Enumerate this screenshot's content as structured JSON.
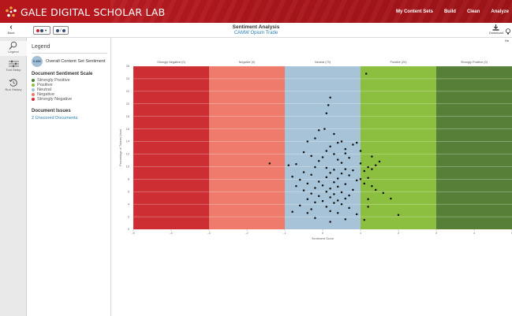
{
  "header": {
    "brand": "GALE DIGITAL SCHOLAR LAB",
    "nav": [
      "My Content Sets",
      "Build",
      "Clean",
      "Analyze"
    ]
  },
  "toolbar": {
    "back_label": "Back",
    "title": "Sentiment Analysis",
    "subtitle": "CAMW Opium Trade",
    "download_label": "Download",
    "help_label": "He"
  },
  "rail": {
    "items": [
      {
        "label": "Legend",
        "icon": "legend-icon"
      },
      {
        "label": "Tool Setup",
        "icon": "sliders-icon"
      },
      {
        "label": "Run History",
        "icon": "history-icon"
      }
    ]
  },
  "legend": {
    "title": "Legend",
    "overall_value": "0.452",
    "overall_label": "Overall Content Set Sentiment",
    "scale_title": "Document Sentiment Scale",
    "scale": [
      {
        "label": "Strongly Positive",
        "color": "#4b7a32"
      },
      {
        "label": "Positive",
        "color": "#8cbf3f"
      },
      {
        "label": "Neutral",
        "color": "#a3bfd6"
      },
      {
        "label": "Negative",
        "color": "#e8796b"
      },
      {
        "label": "Strongly Negative",
        "color": "#cc2e33"
      }
    ],
    "issues_title": "Document Issues",
    "issues_link": "2 Unscored Documents"
  },
  "chart_data": {
    "type": "scatter",
    "xlabel": "Sentiment Score",
    "ylabel": "Percentage of Tokens Used",
    "xlim": [
      -5,
      5
    ],
    "ylim": [
      0,
      26
    ],
    "x_ticks": [
      -5,
      -4,
      -3,
      -2,
      -1,
      0,
      1,
      2,
      3,
      4,
      5
    ],
    "y_ticks": [
      0,
      2,
      4,
      6,
      8,
      10,
      12,
      14,
      16,
      18,
      20,
      22,
      24,
      26
    ],
    "bands": [
      {
        "label": "Strongly Negative (0)",
        "from": -5,
        "to": -3,
        "color": "#cc2e33"
      },
      {
        "label": "Negative (0)",
        "from": -3,
        "to": -1,
        "color": "#ee7b6c"
      },
      {
        "label": "Neutral (79)",
        "from": -1,
        "to": 1,
        "color": "#a6c3d8"
      },
      {
        "label": "Positive (20)",
        "from": 1,
        "to": 3,
        "color": "#8cbf3f"
      },
      {
        "label": "Strongly Positive (0)",
        "from": 3,
        "to": 5,
        "color": "#587f38"
      }
    ],
    "points": [
      [
        0.2,
        21
      ],
      [
        0.15,
        19.8
      ],
      [
        0.1,
        18.5
      ],
      [
        0.05,
        16
      ],
      [
        -0.1,
        15.8
      ],
      [
        0.3,
        15.2
      ],
      [
        -0.2,
        14.5
      ],
      [
        -0.4,
        14
      ],
      [
        0.5,
        14
      ],
      [
        0.8,
        13.5
      ],
      [
        0.4,
        13.8
      ],
      [
        0.9,
        13.8
      ],
      [
        0.2,
        13.2
      ],
      [
        0.6,
        12.8
      ],
      [
        0.1,
        12.5
      ],
      [
        0.6,
        12.1
      ],
      [
        0.3,
        12
      ],
      [
        -0.3,
        11.7
      ],
      [
        0.7,
        11.4
      ],
      [
        0.4,
        11.1
      ],
      [
        -0.1,
        10.9
      ],
      [
        0.5,
        10.6
      ],
      [
        -0.7,
        10.4
      ],
      [
        -0.9,
        10.2
      ],
      [
        -0.2,
        9.9
      ],
      [
        0.1,
        9.8
      ],
      [
        0.6,
        9.6
      ],
      [
        0.3,
        9.5
      ],
      [
        0.8,
        9.4
      ],
      [
        -0.5,
        9.1
      ],
      [
        0.2,
        9.0
      ],
      [
        0.5,
        8.9
      ],
      [
        -0.3,
        8.7
      ],
      [
        0.7,
        8.6
      ],
      [
        -0.8,
        8.4
      ],
      [
        0.1,
        8.3
      ],
      [
        0.4,
        8.1
      ],
      [
        -0.6,
        7.9
      ],
      [
        0.9,
        7.8
      ],
      [
        -0.1,
        7.6
      ],
      [
        0.3,
        7.5
      ],
      [
        -0.4,
        7.3
      ],
      [
        0.6,
        7.2
      ],
      [
        0.0,
        7.0
      ],
      [
        -0.7,
        6.9
      ],
      [
        0.4,
        6.8
      ],
      [
        -0.2,
        6.6
      ],
      [
        0.2,
        6.5
      ],
      [
        0.8,
        6.3
      ],
      [
        -0.5,
        6.2
      ],
      [
        0.1,
        6.0
      ],
      [
        0.5,
        5.9
      ],
      [
        -0.3,
        5.7
      ],
      [
        0.3,
        5.6
      ],
      [
        0.7,
        5.4
      ],
      [
        -0.1,
        5.3
      ],
      [
        0.2,
        5.1
      ],
      [
        0.6,
        4.9
      ],
      [
        -0.4,
        4.8
      ],
      [
        0.4,
        4.6
      ],
      [
        0.0,
        4.5
      ],
      [
        -0.2,
        4.3
      ],
      [
        0.3,
        4.2
      ],
      [
        0.5,
        4.0
      ],
      [
        -0.6,
        3.8
      ],
      [
        0.1,
        3.6
      ],
      [
        0.7,
        3.4
      ],
      [
        -0.3,
        3.2
      ],
      [
        0.2,
        2.9
      ],
      [
        -0.8,
        2.8
      ],
      [
        0.4,
        2.6
      ],
      [
        0.9,
        2.4
      ],
      [
        0.2,
        1.2
      ],
      [
        -0.2,
        1.8
      ],
      [
        0.6,
        1.6
      ],
      [
        1.0,
        10.5
      ],
      [
        1.2,
        9.9
      ],
      [
        1.4,
        10.2
      ],
      [
        1.3,
        11.6
      ],
      [
        1.5,
        10.8
      ],
      [
        1.1,
        9.3
      ],
      [
        1.2,
        8.2
      ],
      [
        1.4,
        6.3
      ],
      [
        1.6,
        5.8
      ],
      [
        1.8,
        4.9
      ],
      [
        1.1,
        7.3
      ],
      [
        1.3,
        6.9
      ],
      [
        1.2,
        4.8
      ],
      [
        2.0,
        2.3
      ],
      [
        1.1,
        1.5
      ],
      [
        1.15,
        24.8
      ],
      [
        1.0,
        12.5
      ],
      [
        1.3,
        9.6
      ],
      [
        1.2,
        3.6
      ],
      [
        -1.4,
        10.5
      ],
      [
        -0.5,
        12.3
      ],
      [
        0.0,
        11.5
      ],
      [
        -0.4,
        2.6
      ],
      [
        1.0,
        8.0
      ]
    ]
  }
}
